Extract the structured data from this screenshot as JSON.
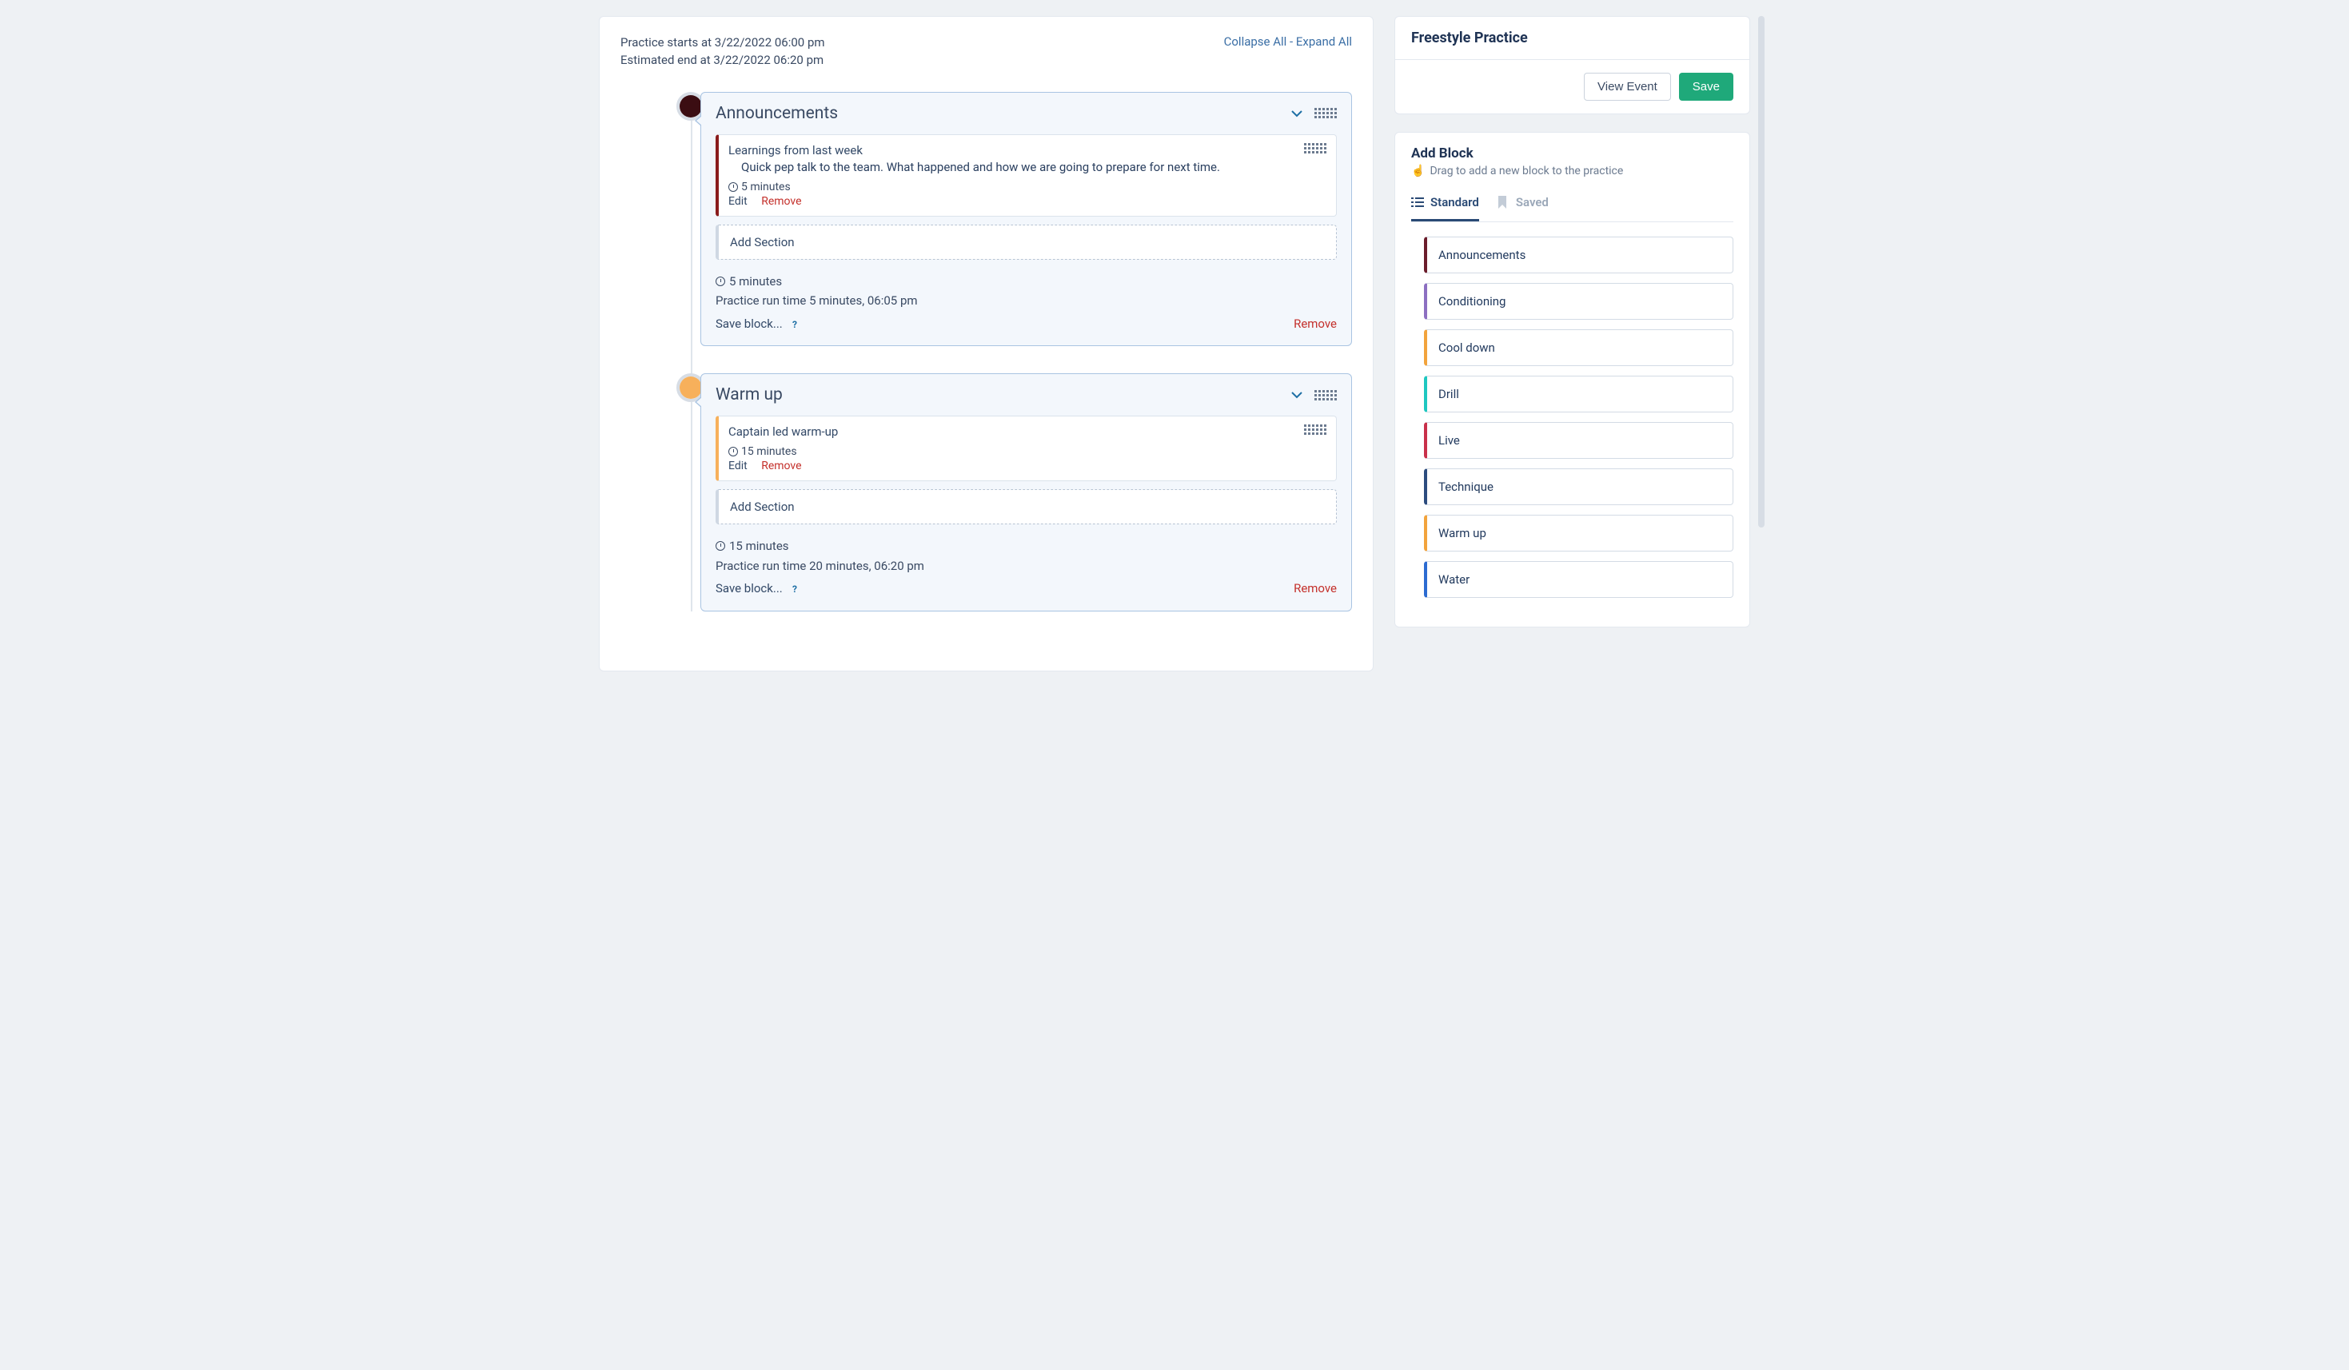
{
  "header": {
    "practice_start": "Practice starts at 3/22/2022 06:00 pm",
    "estimated_end": "Estimated end at 3/22/2022 06:20 pm",
    "collapse_all": "Collapse All",
    "expand_all": "Expand All",
    "dash": " - "
  },
  "blocks": [
    {
      "title": "Announcements",
      "color": "red",
      "sections": [
        {
          "title": "Learnings from last week",
          "desc": "Quick pep talk to the team. What happened and how we are going to prepare for next time.",
          "time": "5 minutes",
          "edit": "Edit",
          "remove": "Remove"
        }
      ],
      "add_section": "Add Section",
      "footer_time": "5 minutes",
      "footer_run": "Practice run time 5 minutes, 06:05 pm",
      "save_block": "Save block...",
      "remove": "Remove"
    },
    {
      "title": "Warm up",
      "color": "orange",
      "sections": [
        {
          "title": "Captain led warm-up",
          "desc": "",
          "time": "15 minutes",
          "edit": "Edit",
          "remove": "Remove"
        }
      ],
      "add_section": "Add Section",
      "footer_time": "15 minutes",
      "footer_run": "Practice run time 20 minutes, 06:20 pm",
      "save_block": "Save block...",
      "remove": "Remove"
    }
  ],
  "sidebar": {
    "title": "Freestyle Practice",
    "view_event": "View Event",
    "save": "Save",
    "add_block_title": "Add Block",
    "add_block_hint": "Drag to add a new block to the practice",
    "tabs": {
      "standard": "Standard",
      "saved": "Saved"
    },
    "block_types": [
      {
        "label": "Announcements",
        "cls": "bt-ann"
      },
      {
        "label": "Conditioning",
        "cls": "bt-cond"
      },
      {
        "label": "Cool down",
        "cls": "bt-cool"
      },
      {
        "label": "Drill",
        "cls": "bt-drill"
      },
      {
        "label": "Live",
        "cls": "bt-live"
      },
      {
        "label": "Technique",
        "cls": "bt-tech"
      },
      {
        "label": "Warm up",
        "cls": "bt-warm"
      },
      {
        "label": "Water",
        "cls": "bt-water"
      }
    ]
  },
  "misc": {
    "help_char": "?"
  }
}
